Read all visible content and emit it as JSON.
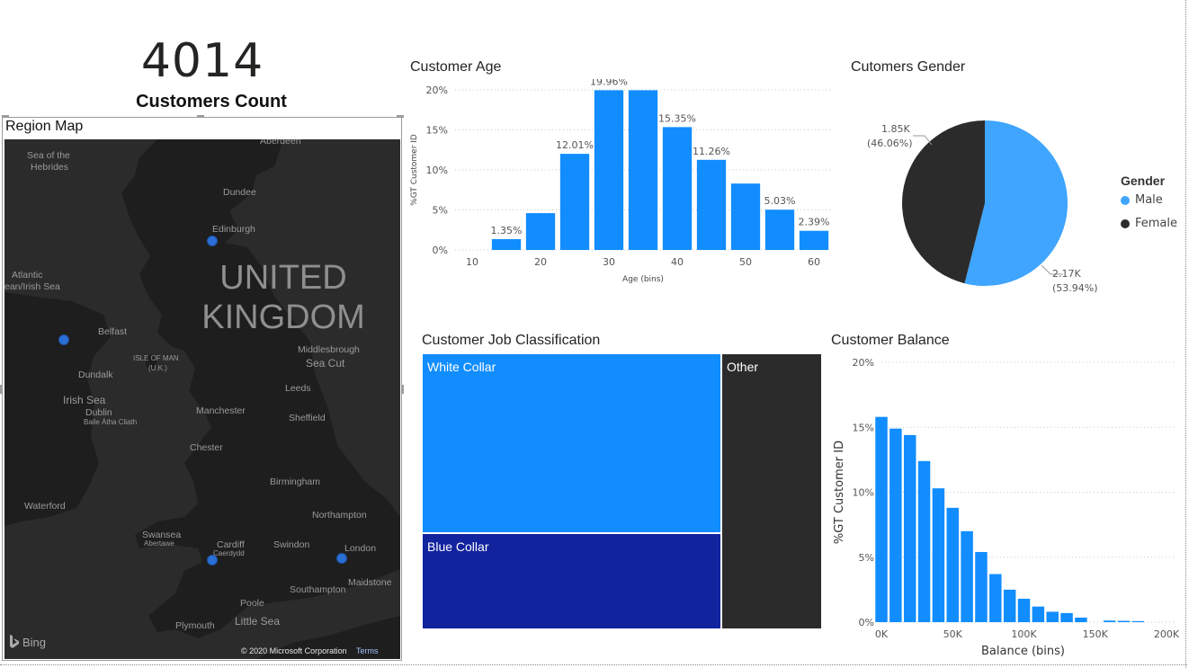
{
  "kpi": {
    "value": "4014",
    "label": "Customers Count"
  },
  "map": {
    "title": "Region Map",
    "country_label_line1": "UNITED",
    "country_label_line2": "KINGDOM",
    "places": [
      {
        "name": "Sea of the",
        "cls": "sea"
      },
      {
        "name": "Hebrides",
        "cls": "sea"
      },
      {
        "name": "Aberdeen",
        "cls": "city"
      },
      {
        "name": "Dundee",
        "cls": "city"
      },
      {
        "name": "Edinburgh",
        "cls": "city"
      },
      {
        "name": "Atlantic",
        "cls": "sea"
      },
      {
        "name": "ean/Irish Sea",
        "cls": "sea"
      },
      {
        "name": "Belfast",
        "cls": "city"
      },
      {
        "name": "ISLE OF MAN",
        "cls": "small"
      },
      {
        "name": "(U.K.)",
        "cls": "small"
      },
      {
        "name": "Middlesbrough",
        "cls": "city"
      },
      {
        "name": "Sea Cut",
        "cls": "sea"
      },
      {
        "name": "Dundalk",
        "cls": "city"
      },
      {
        "name": "Leeds",
        "cls": "city"
      },
      {
        "name": "Irish Sea",
        "cls": "sea"
      },
      {
        "name": "Dublin",
        "cls": "city"
      },
      {
        "name": "Baile Átha Cliath",
        "cls": "small"
      },
      {
        "name": "Manchester",
        "cls": "city"
      },
      {
        "name": "Sheffield",
        "cls": "city"
      },
      {
        "name": "Chester",
        "cls": "city"
      },
      {
        "name": "Birmingham",
        "cls": "city"
      },
      {
        "name": "Waterford",
        "cls": "city"
      },
      {
        "name": "Northampton",
        "cls": "city"
      },
      {
        "name": "Swansea",
        "cls": "city"
      },
      {
        "name": "Abertawe",
        "cls": "small"
      },
      {
        "name": "Cardiff",
        "cls": "city"
      },
      {
        "name": "Caerdydd",
        "cls": "small"
      },
      {
        "name": "Swindon",
        "cls": "city"
      },
      {
        "name": "London",
        "cls": "city"
      },
      {
        "name": "Maidstone",
        "cls": "city"
      },
      {
        "name": "Southampton",
        "cls": "city"
      },
      {
        "name": "Poole",
        "cls": "city"
      },
      {
        "name": "Plymouth",
        "cls": "city"
      },
      {
        "name": "Little Sea",
        "cls": "sea"
      }
    ],
    "attribution": "© 2020 Microsoft Corporation",
    "terms": "Terms",
    "bing": "Bing",
    "dot_color": "#2a6fd6"
  },
  "age_chart": {
    "title": "Customer Age",
    "chart_data": {
      "type": "bar",
      "x_ticks": [
        "10",
        "20",
        "30",
        "40",
        "50",
        "60"
      ],
      "bins": [
        15,
        20,
        25,
        30,
        35,
        40,
        45,
        50,
        55,
        60
      ],
      "values": [
        1.35,
        4.6,
        12.01,
        19.96,
        19.96,
        15.35,
        11.26,
        8.3,
        5.03,
        2.39
      ],
      "data_labels": [
        "1.35%",
        "",
        "12.01%",
        "19.96%",
        "",
        "15.35%",
        "11.26%",
        "",
        "5.03%",
        "2.39%"
      ],
      "y_ticks": [
        "0%",
        "5%",
        "10%",
        "15%",
        "20%"
      ],
      "ylim": [
        0,
        20
      ],
      "xlabel": "Age (bins)",
      "ylabel": "%GT Customer ID",
      "color": "#118dff"
    }
  },
  "gender_chart": {
    "title": "Cutomers Gender",
    "chart_data": {
      "type": "pie",
      "slices": [
        {
          "name": "Male",
          "value": 53.94,
          "label": "2.17K",
          "pct": "(53.94%)",
          "color": "#3fa5ff"
        },
        {
          "name": "Female",
          "value": 46.06,
          "label": "1.85K",
          "pct": "(46.06%)",
          "color": "#2b2b2b"
        }
      ]
    },
    "legend_title": "Gender"
  },
  "job_chart": {
    "title": "Customer Job Classification",
    "chart_data": {
      "type": "treemap",
      "items": [
        {
          "name": "White Collar",
          "color": "#118dff"
        },
        {
          "name": "Blue Collar",
          "color": "#12239e"
        },
        {
          "name": "Other",
          "color": "#2b2b2b"
        }
      ]
    }
  },
  "balance_chart": {
    "title": "Customer Balance",
    "chart_data": {
      "type": "bar",
      "x_ticks": [
        "0K",
        "50K",
        "100K",
        "150K",
        "200K"
      ],
      "bin_starts": [
        0,
        10000,
        20000,
        30000,
        40000,
        50000,
        60000,
        70000,
        80000,
        90000,
        100000,
        110000,
        120000,
        130000,
        140000,
        150000,
        160000,
        170000,
        180000
      ],
      "values": [
        15.8,
        14.9,
        14.4,
        12.4,
        10.3,
        8.8,
        7.0,
        5.4,
        3.7,
        2.5,
        1.8,
        1.2,
        0.8,
        0.7,
        0.35,
        0.0,
        0.12,
        0.1,
        0.08
      ],
      "y_ticks": [
        "0%",
        "5%",
        "10%",
        "15%",
        "20%"
      ],
      "ylim": [
        0,
        20
      ],
      "xlim": [
        0,
        200000
      ],
      "xlabel": "Balance (bins)",
      "ylabel": "%GT Customer ID",
      "color": "#118dff"
    }
  }
}
